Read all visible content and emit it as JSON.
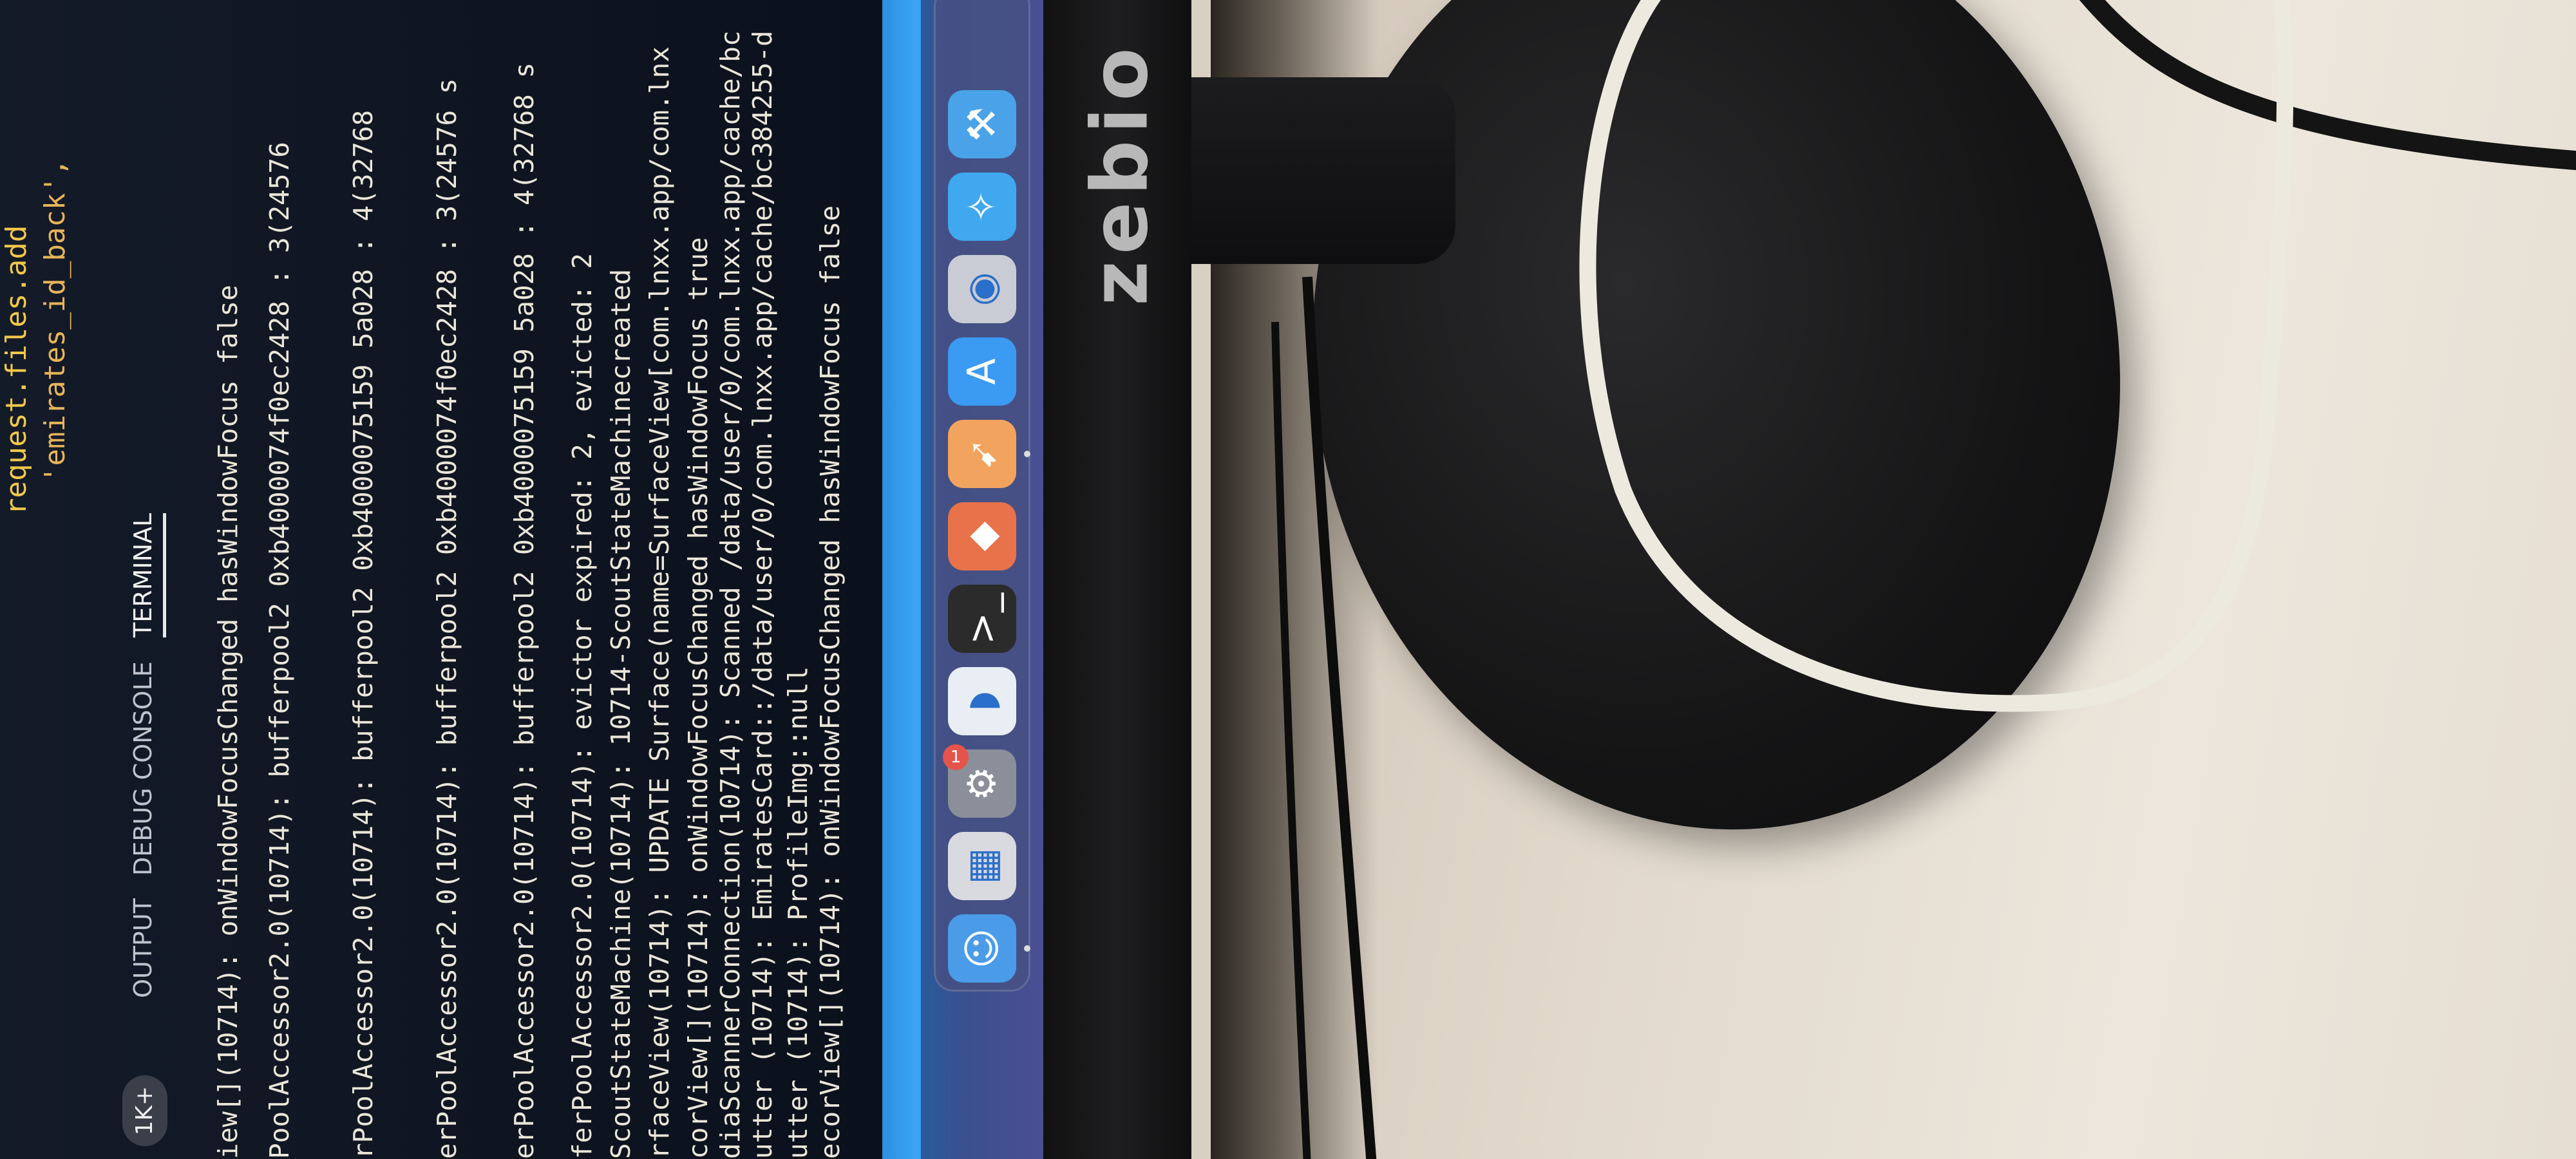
{
  "brand": {
    "name": "zebio"
  },
  "panel": {
    "badge": "1K+",
    "tabs": [
      {
        "label": "OUTPUT",
        "active": false
      },
      {
        "label": "DEBUG CONSOLE",
        "active": false
      },
      {
        "label": "TERMINAL",
        "active": true
      }
    ]
  },
  "code": {
    "line1": "request.files.add",
    "line2": "'emirates_id_back',"
  },
  "terminal": {
    "lines": [
      "iew[](10714): onWindowFocusChanged hasWindowFocus false",
      "PoolAccessor2.0(10714): bufferpool2 0xb4000074f0ec2428 : 3(24576",
      "rPoolAccessor2.0(10714): bufferpool2 0xb4000075159 5a028 : 4(32768",
      "erPoolAccessor2.0(10714): bufferpool2 0xb4000074f0ec2428 : 3(24576 s",
      "erPoolAccessor2.0(10714): bufferpool2 0xb4000075159 5a028 : 4(32768 s",
      "ferPoolAccessor2.0(10714): evictor expired: 2, evicted: 2",
      "ScoutStateMachine(10714): 10714-ScoutStateMachinecreated",
      "rfaceView(10714): UPDATE Surface(name=SurfaceView[com.lnxx.app/com.lnx",
      "corView[](10714): onWindowFocusChanged hasWindowFocus true",
      "diaScannerConnection(10714): Scanned /data/user/0/com.lnxx.app/cache/bc",
      "utter (10714): EmiratesCard::/data/user/0/com.lnxx.app/cache/bc384255-d",
      "utter (10714): ProfileImg::null",
      "ecorView[](10714): onWindowFocusChanged hasWindowFocus false"
    ]
  },
  "dock": {
    "icons": [
      {
        "name": "finder-icon",
        "color": "#4a9be8",
        "glyph": "☺"
      },
      {
        "name": "launchpad-icon",
        "color": "#d9d9e0",
        "glyph": "▦"
      },
      {
        "name": "system-settings-icon",
        "color": "#8a8f99",
        "glyph": "⚙",
        "badge": "1"
      },
      {
        "name": "vscode-icon",
        "color": "#e9eef5",
        "glyph": "◗"
      },
      {
        "name": "terminal-icon",
        "color": "#2b2b2b",
        "glyph": ">_"
      },
      {
        "name": "git-tool-icon",
        "color": "#e8724a",
        "glyph": "◆"
      },
      {
        "name": "postman-icon",
        "color": "#f2a45e",
        "glyph": "➹"
      },
      {
        "name": "app-store-icon",
        "color": "#3b9af2",
        "glyph": "A"
      },
      {
        "name": "screenshot-icon",
        "color": "#c9ccd4",
        "glyph": "◉"
      },
      {
        "name": "safari-icon",
        "color": "#3fa8ef",
        "glyph": "✧"
      },
      {
        "name": "xcode-icon",
        "color": "#4aa3e8",
        "glyph": "⚒"
      }
    ]
  }
}
